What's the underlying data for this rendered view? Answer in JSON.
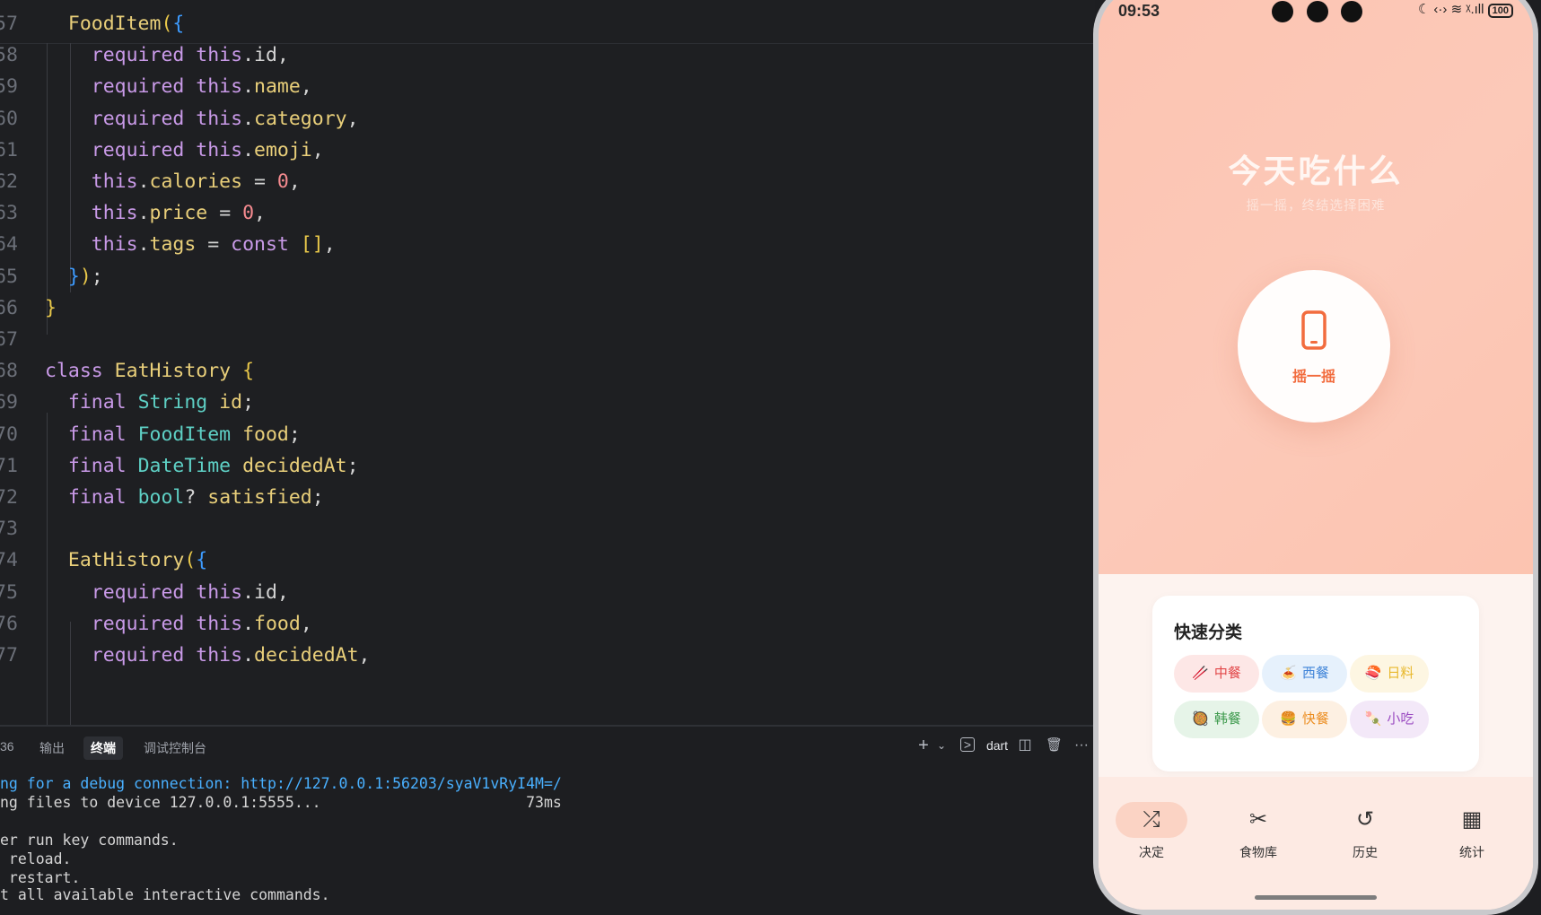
{
  "editor": {
    "lines": [
      {
        "n": "57",
        "tokens": [
          [
            "  ",
            "p"
          ],
          [
            "FoodItem",
            "cls"
          ],
          [
            "(",
            "br"
          ],
          [
            "{",
            "br2"
          ]
        ]
      },
      {
        "n": "58",
        "tokens": [
          [
            "    ",
            "p"
          ],
          [
            "required",
            "kw"
          ],
          [
            " this",
            "kw"
          ],
          [
            ".id,",
            "p"
          ]
        ]
      },
      {
        "n": "59",
        "tokens": [
          [
            "    ",
            "p"
          ],
          [
            "required",
            "kw"
          ],
          [
            " this",
            "kw"
          ],
          [
            ".",
            "p"
          ],
          [
            "name",
            "id"
          ],
          [
            ",",
            "p"
          ]
        ]
      },
      {
        "n": "60",
        "tokens": [
          [
            "    ",
            "p"
          ],
          [
            "required",
            "kw"
          ],
          [
            " this",
            "kw"
          ],
          [
            ".",
            "p"
          ],
          [
            "category",
            "id"
          ],
          [
            ",",
            "p"
          ]
        ]
      },
      {
        "n": "61",
        "tokens": [
          [
            "    ",
            "p"
          ],
          [
            "required",
            "kw"
          ],
          [
            " this",
            "kw"
          ],
          [
            ".",
            "p"
          ],
          [
            "emoji",
            "id"
          ],
          [
            ",",
            "p"
          ]
        ]
      },
      {
        "n": "62",
        "tokens": [
          [
            "    ",
            "p"
          ],
          [
            "this",
            "kw"
          ],
          [
            ".",
            "p"
          ],
          [
            "calories",
            "id"
          ],
          [
            " = ",
            "p"
          ],
          [
            "0",
            "num"
          ],
          [
            ",",
            "p"
          ]
        ]
      },
      {
        "n": "63",
        "tokens": [
          [
            "    ",
            "p"
          ],
          [
            "this",
            "kw"
          ],
          [
            ".",
            "p"
          ],
          [
            "price",
            "id"
          ],
          [
            " = ",
            "p"
          ],
          [
            "0",
            "num"
          ],
          [
            ",",
            "p"
          ]
        ]
      },
      {
        "n": "64",
        "tokens": [
          [
            "    ",
            "p"
          ],
          [
            "this",
            "kw"
          ],
          [
            ".",
            "p"
          ],
          [
            "tags",
            "id"
          ],
          [
            " = ",
            "p"
          ],
          [
            "const",
            "kw"
          ],
          [
            " []",
            "br"
          ],
          [
            ",",
            "p"
          ]
        ]
      },
      {
        "n": "65",
        "tokens": [
          [
            "  ",
            "p"
          ],
          [
            "}",
            "br2"
          ],
          [
            ")",
            "br"
          ],
          [
            ";",
            "p"
          ]
        ]
      },
      {
        "n": "66",
        "tokens": [
          [
            "}",
            "br"
          ]
        ]
      },
      {
        "n": "67",
        "tokens": []
      },
      {
        "n": "68",
        "tokens": [
          [
            "class",
            "kw"
          ],
          [
            " EatHistory ",
            "cls"
          ],
          [
            "{",
            "br"
          ]
        ]
      },
      {
        "n": "69",
        "tokens": [
          [
            "  ",
            "p"
          ],
          [
            "final",
            "kw"
          ],
          [
            " String",
            "ty"
          ],
          [
            " id",
            "id"
          ],
          [
            ";",
            "p"
          ]
        ]
      },
      {
        "n": "70",
        "tokens": [
          [
            "  ",
            "p"
          ],
          [
            "final",
            "kw"
          ],
          [
            " FoodItem",
            "ty"
          ],
          [
            " food",
            "id"
          ],
          [
            ";",
            "p"
          ]
        ]
      },
      {
        "n": "71",
        "tokens": [
          [
            "  ",
            "p"
          ],
          [
            "final",
            "kw"
          ],
          [
            " DateTime",
            "ty"
          ],
          [
            " decidedAt",
            "id"
          ],
          [
            ";",
            "p"
          ]
        ]
      },
      {
        "n": "72",
        "tokens": [
          [
            "  ",
            "p"
          ],
          [
            "final",
            "kw"
          ],
          [
            " bool",
            "ty"
          ],
          [
            "? ",
            "p"
          ],
          [
            "satisfied",
            "id"
          ],
          [
            ";",
            "p"
          ]
        ]
      },
      {
        "n": "73",
        "tokens": []
      },
      {
        "n": "74",
        "tokens": [
          [
            "  ",
            "p"
          ],
          [
            "EatHistory",
            "cls"
          ],
          [
            "(",
            "br"
          ],
          [
            "{",
            "br2"
          ]
        ]
      },
      {
        "n": "75",
        "tokens": [
          [
            "    ",
            "p"
          ],
          [
            "required",
            "kw"
          ],
          [
            " this",
            "kw"
          ],
          [
            ".id,",
            "p"
          ]
        ]
      },
      {
        "n": "76",
        "tokens": [
          [
            "    ",
            "p"
          ],
          [
            "required",
            "kw"
          ],
          [
            " this",
            "kw"
          ],
          [
            ".",
            "p"
          ],
          [
            "food",
            "id"
          ],
          [
            ",",
            "p"
          ]
        ]
      },
      {
        "n": "77",
        "tokens": [
          [
            "    ",
            "p"
          ],
          [
            "required",
            "kw"
          ],
          [
            " this",
            "kw"
          ],
          [
            ".",
            "p"
          ],
          [
            "decidedAt",
            "id"
          ],
          [
            ",",
            "p"
          ]
        ]
      }
    ]
  },
  "panel": {
    "tabs": {
      "problems_count": "36",
      "output": "输出",
      "terminal": "终端",
      "debug_console": "调试控制台"
    },
    "toolbar": {
      "add": "+",
      "dropdown": "⌄",
      "shell_label": "dart",
      "split": "◫",
      "trash": "🗑",
      "more": "···"
    },
    "terminal_lines": [
      {
        "prefix": "ng for a debug connection: ",
        "url": "http://127.0.0.1:56203/syaV1vRyI4M=/"
      },
      {
        "text": "ng files to device 127.0.0.1:5555...                       73ms"
      },
      {
        "text": ""
      },
      {
        "text": "er run key commands."
      },
      {
        "text": " reload."
      },
      {
        "text": " restart."
      },
      {
        "text": "t all available interactive commands."
      }
    ]
  },
  "phone": {
    "status": {
      "time": "09:53",
      "icons": "☾ ‹·› ≋ ᵡ.ıll",
      "battery": "100"
    },
    "hero": {
      "title": "今天吃什么",
      "subtitle": "摇一摇，终结选择困难"
    },
    "shake": {
      "label": "摇一摇"
    },
    "quick": {
      "title": "快速分类",
      "chips": [
        {
          "emoji": "🥢",
          "label": "中餐",
          "bg": "#fde7e6",
          "fg": "#e2484a"
        },
        {
          "emoji": "🍝",
          "label": "西餐",
          "bg": "#e6f1fc",
          "fg": "#3f84d8"
        },
        {
          "emoji": "🍣",
          "label": "日料",
          "bg": "#fdf6e2",
          "fg": "#e8b82c"
        },
        {
          "emoji": "🥘",
          "label": "韩餐",
          "bg": "#e6f4e8",
          "fg": "#3d9a4d"
        },
        {
          "emoji": "🍔",
          "label": "快餐",
          "bg": "#fdf0e2",
          "fg": "#ec8e22"
        },
        {
          "emoji": "🍡",
          "label": "小吃",
          "bg": "#f3e8f8",
          "fg": "#9b4cc2"
        }
      ]
    },
    "nav": [
      {
        "icon": "⤮",
        "label": "决定",
        "active": true
      },
      {
        "icon": "✂",
        "label": "食物库",
        "active": false
      },
      {
        "icon": "↺",
        "label": "历史",
        "active": false
      },
      {
        "icon": "▦",
        "label": "统计",
        "active": false
      }
    ]
  }
}
